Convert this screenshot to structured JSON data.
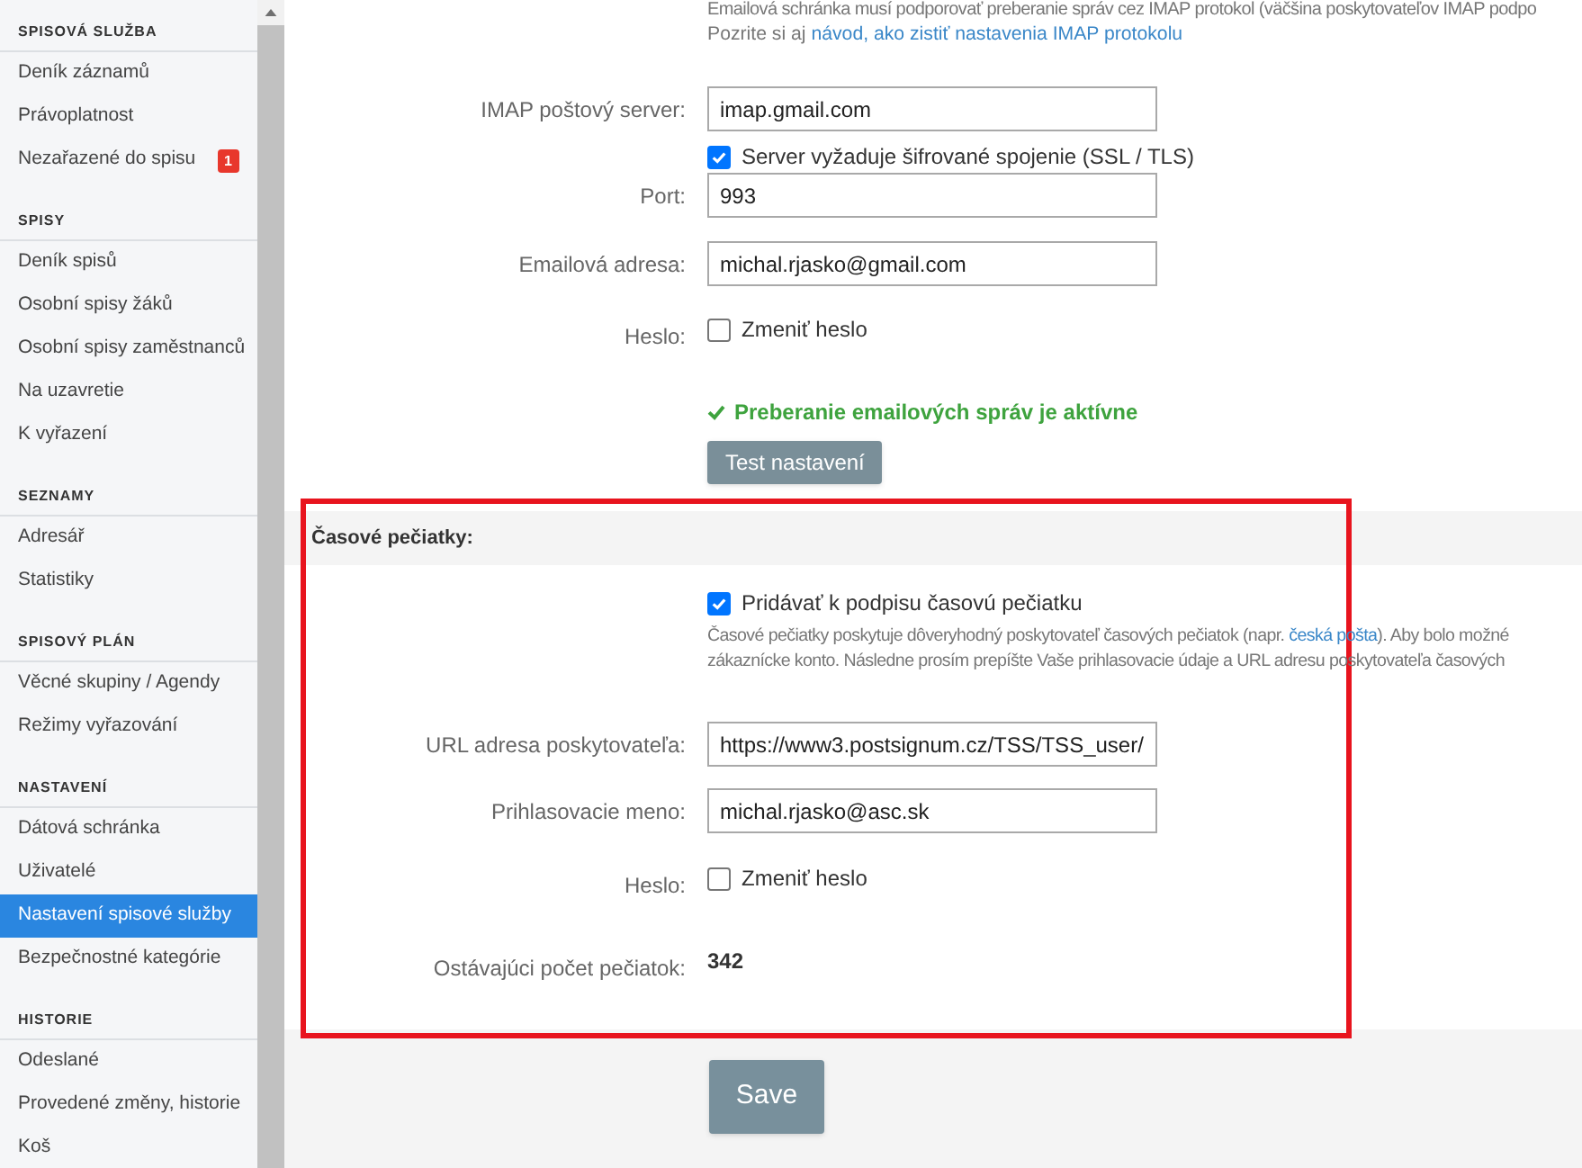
{
  "sidebar": {
    "sections": [
      {
        "heading": "SPISOVÁ SLUŽBA",
        "items": [
          {
            "label": "Deník záznamů",
            "selected": false
          },
          {
            "label": "Právoplatnost",
            "selected": false
          },
          {
            "label": "Nezařazené do spisu",
            "selected": false,
            "badge": "1"
          }
        ]
      },
      {
        "heading": "SPISY",
        "items": [
          {
            "label": "Deník spisů",
            "selected": false
          },
          {
            "label": "Osobní spisy žáků",
            "selected": false
          },
          {
            "label": "Osobní spisy zaměstnanců",
            "selected": false
          },
          {
            "label": "Na uzavretie",
            "selected": false
          },
          {
            "label": "K vyřazení",
            "selected": false
          }
        ]
      },
      {
        "heading": "SEZNAMY",
        "items": [
          {
            "label": "Adresář",
            "selected": false
          },
          {
            "label": "Statistiky",
            "selected": false
          }
        ]
      },
      {
        "heading": "SPISOVÝ PLÁN",
        "items": [
          {
            "label": "Věcné skupiny / Agendy",
            "selected": false
          },
          {
            "label": "Režimy vyřazování",
            "selected": false
          }
        ]
      },
      {
        "heading": "NASTAVENÍ",
        "items": [
          {
            "label": "Dátová schránka",
            "selected": false
          },
          {
            "label": "Uživatelé",
            "selected": false
          },
          {
            "label": "Nastavení spisové služby",
            "selected": true
          },
          {
            "label": "Bezpečnostné kategórie",
            "selected": false
          }
        ]
      },
      {
        "heading": "HISTORIE",
        "items": [
          {
            "label": "Odeslané",
            "selected": false
          },
          {
            "label": "Provedené změny, historie",
            "selected": false
          },
          {
            "label": "Koš",
            "selected": false
          }
        ]
      }
    ]
  },
  "email_section": {
    "intro": "Emailová schránka musí podporovať preberanie správ cez IMAP protokol (väčšina poskytovateľov IMAP podpo",
    "hint_prefix": "Pozrite si aj",
    "hint_link": "návod, ako zistiť nastavenia IMAP protokolu",
    "rows": [
      {
        "kind": "input",
        "label": "IMAP poštový server:",
        "value": "imap.gmail.com",
        "option": {
          "label": "Server vyžaduje šifrované spojenie (SSL / TLS)",
          "checked": true
        }
      },
      {
        "kind": "input",
        "label": "Port:",
        "value": "993"
      },
      {
        "kind": "input",
        "label": "Emailová adresa:",
        "value": "michal.rjasko@gmail.com"
      },
      {
        "kind": "checkbox",
        "label": "Heslo:",
        "option": {
          "label": "Zmeniť heslo",
          "checked": false
        }
      },
      {
        "kind": "status",
        "text": "Preberanie emailových správ je aktívne"
      },
      {
        "kind": "button",
        "text": "Test nastavení"
      }
    ]
  },
  "timestamp_section": {
    "title": "Časové pečiatky:",
    "enable": {
      "label": "Pridávať k podpisu časovú pečiatku",
      "checked": true
    },
    "description_before": "Časové pečiatky poskytuje dôveryhodný poskytovateľ časových pečiatok (napr.",
    "description_link": "česká pošta",
    "description_after": "). Aby bolo možné",
    "description_line2": "zákaznícke konto. Následne prosím prepíšte Vaše prihlasovacie údaje a URL adresu poskytovateľa časových",
    "rows": [
      {
        "kind": "input",
        "label": "URL adresa poskytovateľa:",
        "value": "https://www3.postsignum.cz/TSS/TSS_user/"
      },
      {
        "kind": "input",
        "label": "Prihlasovacie meno:",
        "value": "michal.rjasko@asc.sk"
      },
      {
        "kind": "checkbox",
        "label": "Heslo:",
        "option": {
          "label": "Zmeniť heslo",
          "checked": false
        }
      },
      {
        "kind": "value",
        "label": "Ostávajúci počet pečiatok:",
        "value": "342"
      }
    ]
  },
  "save_button": "Save"
}
